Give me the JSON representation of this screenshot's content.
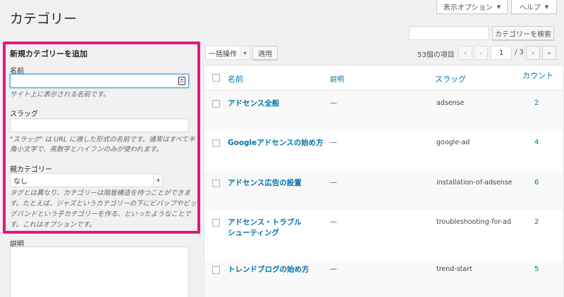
{
  "page": {
    "title": "カテゴリー"
  },
  "top_buttons": {
    "screen_options": "表示オプション",
    "help": "ヘルプ"
  },
  "search": {
    "placeholder": "",
    "button": "カテゴリーを検索"
  },
  "add_form": {
    "heading": "新規カテゴリーを追加",
    "name_label": "名前",
    "name_value": "",
    "name_hint": "サイト上に表示される名前です。",
    "slug_label": "スラッグ",
    "slug_value": "",
    "slug_hint_1": "\"スラッグ\" は URL に適した形式の名前です。通常はすべて半",
    "slug_hint_2": "角小文字で、英数字とハイフンのみが使われます。",
    "parent_label": "親カテゴリー",
    "parent_value": "なし",
    "parent_hint_1": "タグとは異なり、カテゴリーは階層構造を持つことができま",
    "parent_hint_2": "す。たとえば、ジャズというカテゴリーの下にビバップやビッ",
    "parent_hint_3": "グバンドという子カテゴリーを作る、といったようなことで",
    "parent_hint_4": "す。これはオプションです。",
    "description_label": "説明"
  },
  "bulk": {
    "action_label": "一括操作",
    "apply": "適用"
  },
  "pagination": {
    "count": "53個の項目",
    "first": "«",
    "prev": "‹",
    "current": "1",
    "total": "/ 3",
    "next": "›",
    "last": "»"
  },
  "table": {
    "headers": {
      "name": "名前",
      "description": "説明",
      "slug": "スラッグ",
      "count": "カウント"
    },
    "rows": [
      {
        "name": "アドセンス全般",
        "description": "—",
        "slug": "adsense",
        "count": "2"
      },
      {
        "name": "Googleアドセンスの始め方",
        "description": "—",
        "slug": "google-ad",
        "count": "4"
      },
      {
        "name": "アドセンス広告の設置",
        "description": "—",
        "slug": "installation-of-adsense",
        "count": "6"
      },
      {
        "name_line1": "アドセンス・トラブル",
        "name_line2": "シューティング",
        "description": "—",
        "slug": "troubleshooting-for-ad",
        "count": "2"
      },
      {
        "name": "トレンドブログの始め方",
        "description": "—",
        "slug": "trend-start",
        "count": "5"
      }
    ]
  },
  "colors": {
    "accent": "#e5167f",
    "link": "#0073aa",
    "background": "#f1f1f1"
  },
  "icons": [
    "chevron-down-icon",
    "key-icon",
    "checkbox-icon"
  ]
}
